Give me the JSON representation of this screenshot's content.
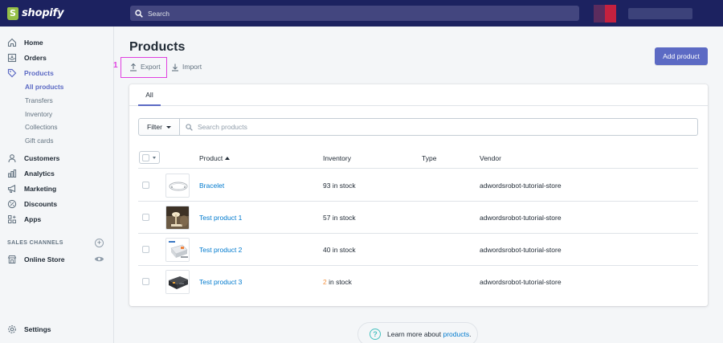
{
  "app": {
    "brand": "shopify"
  },
  "topbar": {
    "search_placeholder": "Search"
  },
  "sidebar": {
    "items": [
      {
        "label": "Home",
        "icon": "home-icon"
      },
      {
        "label": "Orders",
        "icon": "orders-icon"
      },
      {
        "label": "Products",
        "icon": "tag-icon",
        "active": true
      },
      {
        "label": "Customers",
        "icon": "person-icon"
      },
      {
        "label": "Analytics",
        "icon": "bar-chart-icon"
      },
      {
        "label": "Marketing",
        "icon": "megaphone-icon"
      },
      {
        "label": "Discounts",
        "icon": "discount-icon"
      },
      {
        "label": "Apps",
        "icon": "apps-icon"
      }
    ],
    "product_sub": [
      "All products",
      "Transfers",
      "Inventory",
      "Collections",
      "Gift cards"
    ],
    "sales_channels_label": "SALES CHANNELS",
    "online_store": "Online Store",
    "settings": "Settings"
  },
  "page": {
    "title": "Products",
    "export_label": "Export",
    "import_label": "Import",
    "add_button": "Add product",
    "step_marker": "1"
  },
  "tabs": [
    "All"
  ],
  "filter": {
    "button_label": "Filter",
    "search_placeholder": "Search products"
  },
  "table": {
    "columns": [
      "Product",
      "Inventory",
      "Type",
      "Vendor"
    ],
    "rows": [
      {
        "name": "Bracelet",
        "inventory_count": "93",
        "inventory_suffix": " in stock",
        "low_stock": false,
        "type": "",
        "vendor": "adwordsrobot-tutorial-store"
      },
      {
        "name": "Test product 1",
        "inventory_count": "57",
        "inventory_suffix": " in stock",
        "low_stock": false,
        "type": "",
        "vendor": "adwordsrobot-tutorial-store"
      },
      {
        "name": "Test product 2",
        "inventory_count": "40",
        "inventory_suffix": " in stock",
        "low_stock": false,
        "type": "",
        "vendor": "adwordsrobot-tutorial-store"
      },
      {
        "name": "Test product 3",
        "inventory_count": "2",
        "inventory_suffix": " in stock",
        "low_stock": true,
        "type": "",
        "vendor": "adwordsrobot-tutorial-store"
      }
    ]
  },
  "footer": {
    "learn_prefix": "Learn more about ",
    "learn_link": "products",
    "learn_suffix": "."
  },
  "colors": {
    "topbar": "#1c2260",
    "accent": "#5c6ac4",
    "link": "#007ace",
    "low_stock": "#f49342",
    "highlight": "#e040e0"
  }
}
